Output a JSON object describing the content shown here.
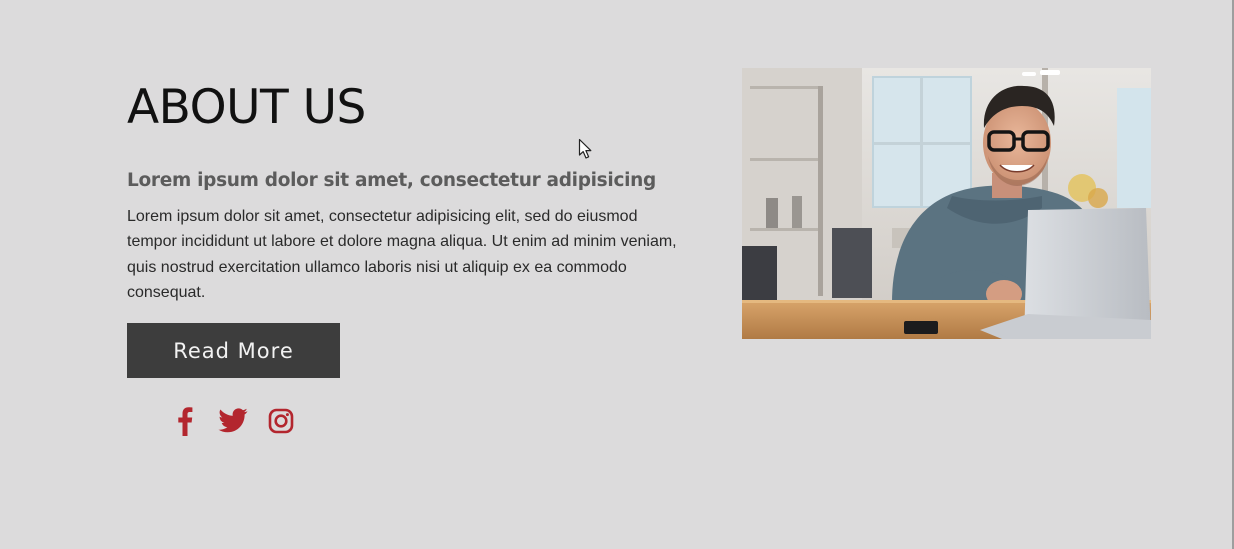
{
  "about": {
    "title": "ABOUT US",
    "subtitle": "Lorem ipsum dolor sit amet, consectetur adipisicing",
    "body": "Lorem ipsum dolor sit amet, consectetur adipisicing elit, sed do eiusmod tempor incididunt ut labore et dolore magna aliqua. Ut enim ad minim veniam, quis nostrud exercitation ullamco laboris nisi ut aliquip ex ea commodo consequat.",
    "button_label": "Read More"
  },
  "social": {
    "icons": [
      "facebook-icon",
      "twitter-icon",
      "instagram-icon"
    ],
    "icon_color": "#b3262e"
  },
  "colors": {
    "background": "#dcdbdc",
    "button_bg": "#3d3d3d",
    "button_text": "#f2f2f2"
  }
}
